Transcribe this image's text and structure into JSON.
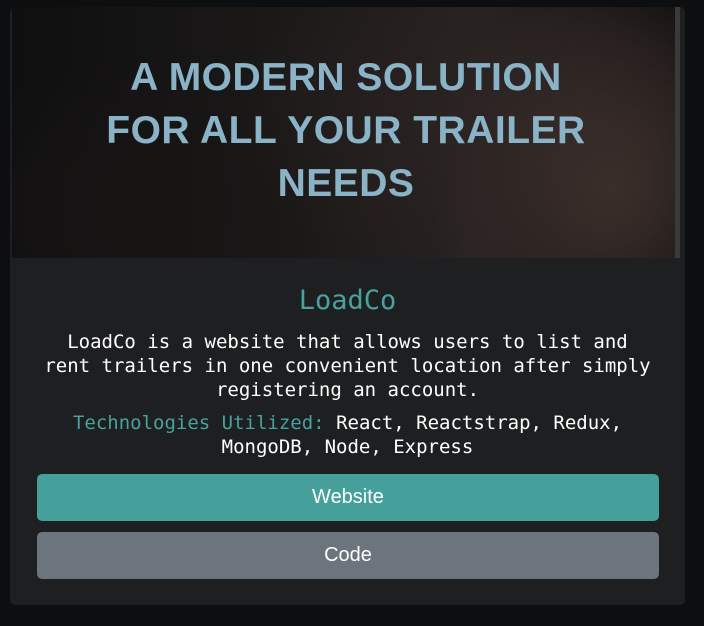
{
  "hero": {
    "lines": [
      "A MODERN SOLUTION",
      "FOR ALL YOUR TRAILER",
      "NEEDS"
    ]
  },
  "project": {
    "title": "LoadCo",
    "description": "LoadCo is a website that allows users to list and rent trailers in one convenient location after simply registering an account.",
    "tech_label": "Technologies Utilized:",
    "tech_list": "React, Reactstrap, Redux, MongoDB, Node, Express"
  },
  "buttons": {
    "website_label": "Website",
    "code_label": "Code"
  },
  "colors": {
    "accent": "#48a29e",
    "website_button": "#45a09c",
    "code_button": "#6c757d",
    "card": "#1d1f21",
    "hero_text": "#8bb3c7"
  }
}
